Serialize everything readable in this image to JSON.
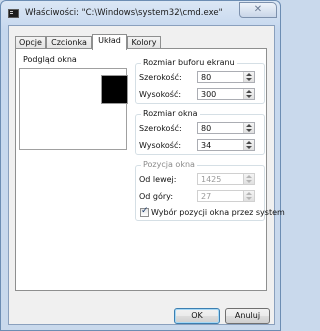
{
  "window": {
    "title": "Właściwości: \"C:\\Windows\\system32\\cmd.exe\"",
    "close_glyph": "✕"
  },
  "tabs": [
    {
      "label": "Opcje"
    },
    {
      "label": "Czcionka"
    },
    {
      "label": "Układ"
    },
    {
      "label": "Kolory"
    }
  ],
  "active_tab": "Układ",
  "preview": {
    "label": "Podgląd okna"
  },
  "buffer": {
    "title": "Rozmiar buforu ekranu",
    "width_label": "Szerokość:",
    "width_value": "80",
    "height_label": "Wysokość:",
    "height_value": "300"
  },
  "window_size": {
    "title": "Rozmiar okna",
    "width_label": "Szerokość:",
    "width_value": "80",
    "height_label": "Wysokość:",
    "height_value": "34"
  },
  "position": {
    "title": "Pozycja okna",
    "left_label": "Od lewej:",
    "left_value": "1425",
    "top_label": "Od góry:",
    "top_value": "27",
    "system_label": "Wybór pozycji okna przez system",
    "system_checked": true
  },
  "buttons": {
    "ok": "OK",
    "cancel": "Anuluj"
  },
  "icons": {
    "app": "console-icon",
    "close": "close-icon"
  }
}
